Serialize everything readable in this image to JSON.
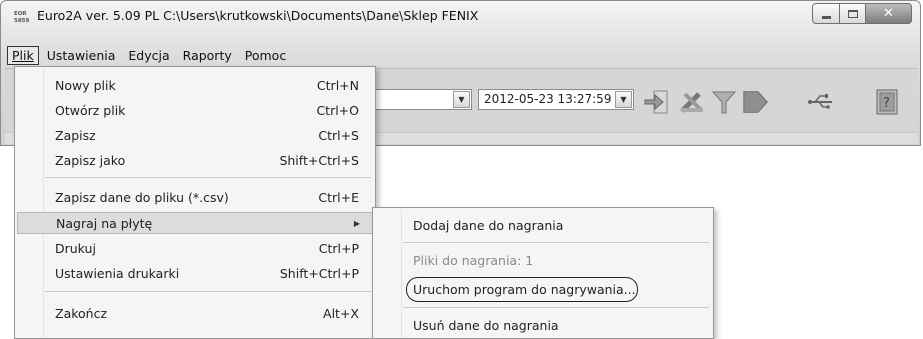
{
  "window": {
    "title": "Euro2A ver. 5.09 PL   C:\\Users\\krutkowski\\Documents\\Dane\\Sklep FENIX",
    "icon_text": "EOR\n5859"
  },
  "menubar": {
    "items": [
      {
        "label": "Plik",
        "active": true
      },
      {
        "label": "Ustawienia",
        "active": false
      },
      {
        "label": "Edycja",
        "active": false
      },
      {
        "label": "Raporty",
        "active": false
      },
      {
        "label": "Pomoc",
        "active": false
      }
    ]
  },
  "toolbar": {
    "date_value": "2012-05-23 13:27:59",
    "icons": [
      "import-icon",
      "tools-icon",
      "filter-icon",
      "export-icon",
      "usb-icon",
      "help-icon"
    ]
  },
  "plik_menu": {
    "items": [
      {
        "label": "Nowy plik",
        "shortcut": "Ctrl+N"
      },
      {
        "label": "Otwórz plik",
        "shortcut": "Ctrl+O"
      },
      {
        "label": "Zapisz",
        "shortcut": "Ctrl+S"
      },
      {
        "label": "Zapisz jako",
        "shortcut": "Shift+Ctrl+S"
      },
      {
        "label": "Zapisz dane do pliku (*.csv)",
        "shortcut": "Ctrl+E"
      },
      {
        "label": "Nagraj na płytę",
        "shortcut": ""
      },
      {
        "label": "Drukuj",
        "shortcut": "Ctrl+P"
      },
      {
        "label": "Ustawienia drukarki",
        "shortcut": "Shift+Ctrl+P"
      },
      {
        "label": "Zakończ",
        "shortcut": "Alt+X"
      }
    ]
  },
  "submenu": {
    "items": [
      {
        "label": "Dodaj dane do nagrania",
        "enabled": true
      },
      {
        "label": "Pliki do nagrania: 1",
        "enabled": false
      },
      {
        "label": "Uruchom program do nagrywania...",
        "enabled": true
      },
      {
        "label": "Usuń dane do nagrania",
        "enabled": true
      }
    ]
  }
}
